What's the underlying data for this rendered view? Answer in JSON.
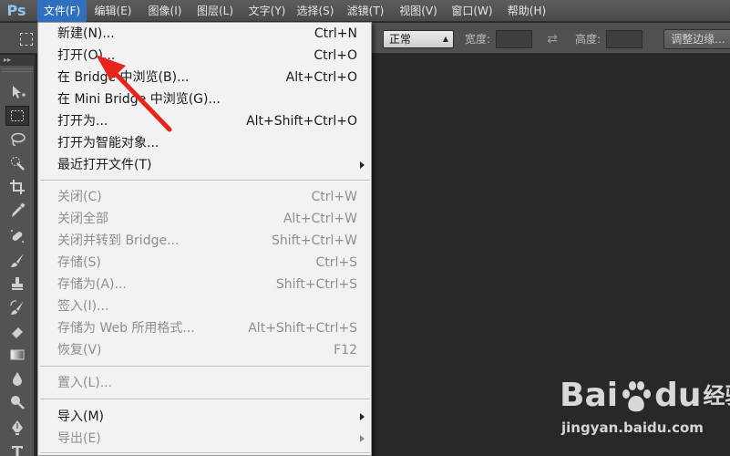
{
  "app": {
    "logo": "Ps"
  },
  "menubar": {
    "items": [
      {
        "label": "文件(F)",
        "active": true
      },
      {
        "label": "编辑(E)"
      },
      {
        "label": "图像(I)"
      },
      {
        "label": "图层(L)"
      },
      {
        "label": "文字(Y)"
      },
      {
        "label": "选择(S)"
      },
      {
        "label": "滤镜(T)"
      },
      {
        "label": "视图(V)"
      },
      {
        "label": "窗口(W)"
      },
      {
        "label": "帮助(H)"
      }
    ]
  },
  "options_bar": {
    "style_value": "正常",
    "width_label": "宽度:",
    "height_label": "高度:",
    "refine_edge_label": "调整边缘..."
  },
  "file_menu": {
    "items": [
      {
        "label": "新建(N)...",
        "shortcut": "Ctrl+N",
        "enabled": true
      },
      {
        "label": "打开(O)...",
        "shortcut": "Ctrl+O",
        "enabled": true
      },
      {
        "label": "在 Bridge 中浏览(B)...",
        "shortcut": "Alt+Ctrl+O",
        "enabled": true
      },
      {
        "label": "在 Mini Bridge 中浏览(G)...",
        "shortcut": "",
        "enabled": true
      },
      {
        "label": "打开为...",
        "shortcut": "Alt+Shift+Ctrl+O",
        "enabled": true
      },
      {
        "label": "打开为智能对象...",
        "shortcut": "",
        "enabled": true
      },
      {
        "label": "最近打开文件(T)",
        "shortcut": "",
        "enabled": true,
        "submenu": true
      },
      {
        "label": "关闭(C)",
        "shortcut": "Ctrl+W",
        "enabled": false
      },
      {
        "label": "关闭全部",
        "shortcut": "Alt+Ctrl+W",
        "enabled": false
      },
      {
        "label": "关闭并转到 Bridge...",
        "shortcut": "Shift+Ctrl+W",
        "enabled": false
      },
      {
        "label": "存储(S)",
        "shortcut": "Ctrl+S",
        "enabled": false
      },
      {
        "label": "存储为(A)...",
        "shortcut": "Shift+Ctrl+S",
        "enabled": false
      },
      {
        "label": "签入(I)...",
        "shortcut": "",
        "enabled": false
      },
      {
        "label": "存储为 Web 所用格式...",
        "shortcut": "Alt+Shift+Ctrl+S",
        "enabled": false
      },
      {
        "label": "恢复(V)",
        "shortcut": "F12",
        "enabled": false
      },
      {
        "label": "置入(L)...",
        "shortcut": "",
        "enabled": false
      },
      {
        "label": "导入(M)",
        "shortcut": "",
        "enabled": true,
        "submenu": true
      },
      {
        "label": "导出(E)",
        "shortcut": "",
        "enabled": false,
        "submenu": true
      }
    ]
  },
  "tools": [
    {
      "icon": "move-tool-icon"
    },
    {
      "icon": "rectangular-marquee-tool-icon",
      "selected": true
    },
    {
      "icon": "lasso-tool-icon"
    },
    {
      "icon": "quick-selection-tool-icon"
    },
    {
      "icon": "crop-tool-icon"
    },
    {
      "icon": "eyedropper-tool-icon"
    },
    {
      "icon": "spot-healing-brush-tool-icon"
    },
    {
      "icon": "brush-tool-icon"
    },
    {
      "icon": "clone-stamp-tool-icon"
    },
    {
      "icon": "history-brush-tool-icon"
    },
    {
      "icon": "eraser-tool-icon"
    },
    {
      "icon": "gradient-tool-icon"
    },
    {
      "icon": "blur-tool-icon"
    },
    {
      "icon": "dodge-tool-icon"
    },
    {
      "icon": "pen-tool-icon"
    },
    {
      "icon": "type-tool-icon"
    }
  ],
  "watermark": {
    "brand_left": "Bai",
    "brand_right": "du",
    "product": "经验",
    "url": "jingyan.baidu.com"
  },
  "colors": {
    "menu_highlight": "#2f6fbd",
    "annotation_arrow": "#e8241c",
    "ps_logo": "#8fc4f2"
  }
}
